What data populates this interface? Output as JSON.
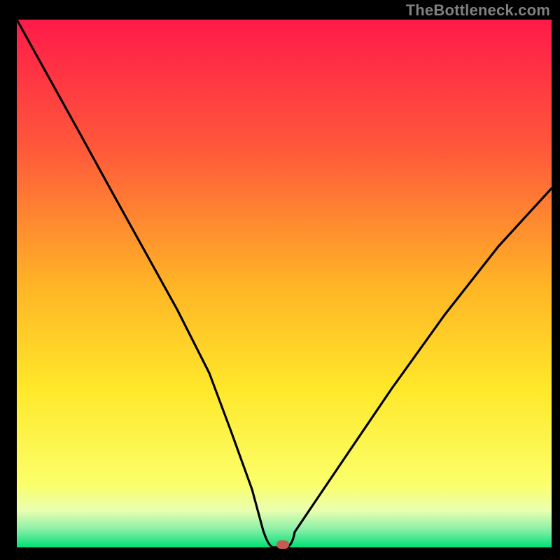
{
  "watermark": "TheBottleneck.com",
  "chart_data": {
    "type": "line",
    "title": "",
    "xlabel": "",
    "ylabel": "",
    "xlim": [
      0,
      100
    ],
    "ylim": [
      0,
      100
    ],
    "notes": "Performance-balance curve on heatmap background. No axis ticks/labels shown. Background is a vertical red→yellow→green gradient with thin green band at bottom. Curve values are approximate, read from pixel positions.",
    "series": [
      {
        "name": "bottleneck-curve",
        "x": [
          0,
          6,
          12,
          18,
          24,
          30,
          36,
          40,
          44,
          46,
          48,
          50,
          52,
          56,
          62,
          70,
          80,
          90,
          100
        ],
        "y": [
          100,
          89,
          78,
          67,
          56,
          45,
          33,
          22,
          11,
          3,
          0,
          0,
          3,
          9,
          18,
          30,
          44,
          57,
          68
        ]
      }
    ],
    "marker": {
      "x": 50,
      "y": 0,
      "color": "#c85a54"
    },
    "background_gradient_stops": [
      {
        "pos": 0.0,
        "color": "#ff1a49"
      },
      {
        "pos": 0.25,
        "color": "#ff5a3a"
      },
      {
        "pos": 0.5,
        "color": "#ffb326"
      },
      {
        "pos": 0.7,
        "color": "#ffe82a"
      },
      {
        "pos": 0.88,
        "color": "#fbff6a"
      },
      {
        "pos": 0.93,
        "color": "#eaffb0"
      },
      {
        "pos": 0.965,
        "color": "#8cf0a8"
      },
      {
        "pos": 1.0,
        "color": "#00e076"
      }
    ]
  }
}
